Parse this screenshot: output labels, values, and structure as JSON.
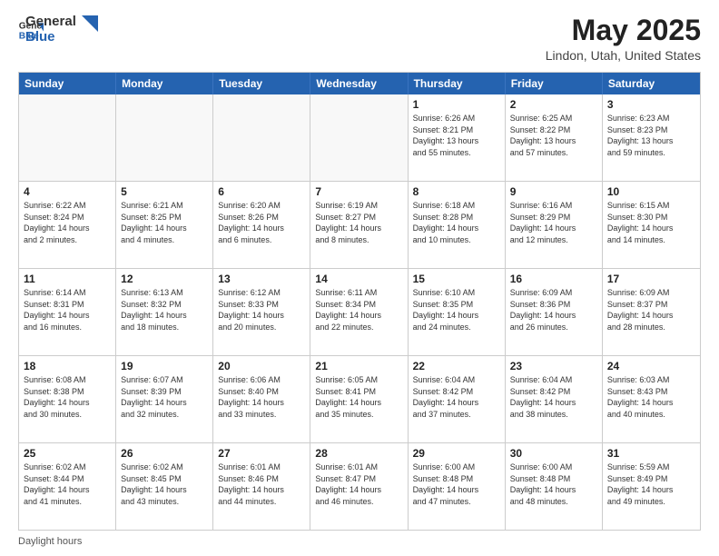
{
  "header": {
    "logo_general": "General",
    "logo_blue": "Blue",
    "month_title": "May 2025",
    "location": "Lindon, Utah, United States"
  },
  "calendar": {
    "days_of_week": [
      "Sunday",
      "Monday",
      "Tuesday",
      "Wednesday",
      "Thursday",
      "Friday",
      "Saturday"
    ],
    "weeks": [
      [
        {
          "day": "",
          "info": "",
          "empty": true
        },
        {
          "day": "",
          "info": "",
          "empty": true
        },
        {
          "day": "",
          "info": "",
          "empty": true
        },
        {
          "day": "",
          "info": "",
          "empty": true
        },
        {
          "day": "1",
          "info": "Sunrise: 6:26 AM\nSunset: 8:21 PM\nDaylight: 13 hours\nand 55 minutes."
        },
        {
          "day": "2",
          "info": "Sunrise: 6:25 AM\nSunset: 8:22 PM\nDaylight: 13 hours\nand 57 minutes."
        },
        {
          "day": "3",
          "info": "Sunrise: 6:23 AM\nSunset: 8:23 PM\nDaylight: 13 hours\nand 59 minutes."
        }
      ],
      [
        {
          "day": "4",
          "info": "Sunrise: 6:22 AM\nSunset: 8:24 PM\nDaylight: 14 hours\nand 2 minutes."
        },
        {
          "day": "5",
          "info": "Sunrise: 6:21 AM\nSunset: 8:25 PM\nDaylight: 14 hours\nand 4 minutes."
        },
        {
          "day": "6",
          "info": "Sunrise: 6:20 AM\nSunset: 8:26 PM\nDaylight: 14 hours\nand 6 minutes."
        },
        {
          "day": "7",
          "info": "Sunrise: 6:19 AM\nSunset: 8:27 PM\nDaylight: 14 hours\nand 8 minutes."
        },
        {
          "day": "8",
          "info": "Sunrise: 6:18 AM\nSunset: 8:28 PM\nDaylight: 14 hours\nand 10 minutes."
        },
        {
          "day": "9",
          "info": "Sunrise: 6:16 AM\nSunset: 8:29 PM\nDaylight: 14 hours\nand 12 minutes."
        },
        {
          "day": "10",
          "info": "Sunrise: 6:15 AM\nSunset: 8:30 PM\nDaylight: 14 hours\nand 14 minutes."
        }
      ],
      [
        {
          "day": "11",
          "info": "Sunrise: 6:14 AM\nSunset: 8:31 PM\nDaylight: 14 hours\nand 16 minutes."
        },
        {
          "day": "12",
          "info": "Sunrise: 6:13 AM\nSunset: 8:32 PM\nDaylight: 14 hours\nand 18 minutes."
        },
        {
          "day": "13",
          "info": "Sunrise: 6:12 AM\nSunset: 8:33 PM\nDaylight: 14 hours\nand 20 minutes."
        },
        {
          "day": "14",
          "info": "Sunrise: 6:11 AM\nSunset: 8:34 PM\nDaylight: 14 hours\nand 22 minutes."
        },
        {
          "day": "15",
          "info": "Sunrise: 6:10 AM\nSunset: 8:35 PM\nDaylight: 14 hours\nand 24 minutes."
        },
        {
          "day": "16",
          "info": "Sunrise: 6:09 AM\nSunset: 8:36 PM\nDaylight: 14 hours\nand 26 minutes."
        },
        {
          "day": "17",
          "info": "Sunrise: 6:09 AM\nSunset: 8:37 PM\nDaylight: 14 hours\nand 28 minutes."
        }
      ],
      [
        {
          "day": "18",
          "info": "Sunrise: 6:08 AM\nSunset: 8:38 PM\nDaylight: 14 hours\nand 30 minutes."
        },
        {
          "day": "19",
          "info": "Sunrise: 6:07 AM\nSunset: 8:39 PM\nDaylight: 14 hours\nand 32 minutes."
        },
        {
          "day": "20",
          "info": "Sunrise: 6:06 AM\nSunset: 8:40 PM\nDaylight: 14 hours\nand 33 minutes."
        },
        {
          "day": "21",
          "info": "Sunrise: 6:05 AM\nSunset: 8:41 PM\nDaylight: 14 hours\nand 35 minutes."
        },
        {
          "day": "22",
          "info": "Sunrise: 6:04 AM\nSunset: 8:42 PM\nDaylight: 14 hours\nand 37 minutes."
        },
        {
          "day": "23",
          "info": "Sunrise: 6:04 AM\nSunset: 8:42 PM\nDaylight: 14 hours\nand 38 minutes."
        },
        {
          "day": "24",
          "info": "Sunrise: 6:03 AM\nSunset: 8:43 PM\nDaylight: 14 hours\nand 40 minutes."
        }
      ],
      [
        {
          "day": "25",
          "info": "Sunrise: 6:02 AM\nSunset: 8:44 PM\nDaylight: 14 hours\nand 41 minutes."
        },
        {
          "day": "26",
          "info": "Sunrise: 6:02 AM\nSunset: 8:45 PM\nDaylight: 14 hours\nand 43 minutes."
        },
        {
          "day": "27",
          "info": "Sunrise: 6:01 AM\nSunset: 8:46 PM\nDaylight: 14 hours\nand 44 minutes."
        },
        {
          "day": "28",
          "info": "Sunrise: 6:01 AM\nSunset: 8:47 PM\nDaylight: 14 hours\nand 46 minutes."
        },
        {
          "day": "29",
          "info": "Sunrise: 6:00 AM\nSunset: 8:48 PM\nDaylight: 14 hours\nand 47 minutes."
        },
        {
          "day": "30",
          "info": "Sunrise: 6:00 AM\nSunset: 8:48 PM\nDaylight: 14 hours\nand 48 minutes."
        },
        {
          "day": "31",
          "info": "Sunrise: 5:59 AM\nSunset: 8:49 PM\nDaylight: 14 hours\nand 49 minutes."
        }
      ]
    ]
  },
  "footer": {
    "note": "Daylight hours"
  }
}
